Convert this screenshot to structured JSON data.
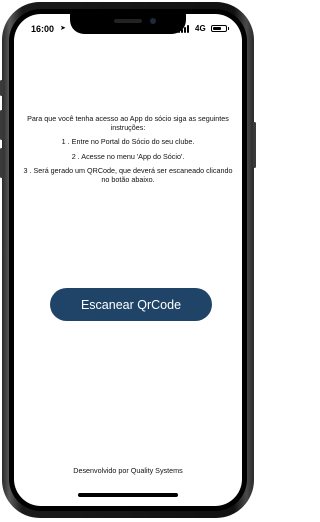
{
  "status_bar": {
    "time": "16:00",
    "network": "4G"
  },
  "instructions": {
    "intro": "Para que você tenha acesso ao App do sócio siga as seguintes instruções:",
    "step1": "1 . Entre no Portal do Sócio do seu clube.",
    "step2": "2 . Acesse no menu 'App do Sócio'.",
    "step3": "3 . Será gerado um QRCode, que deverá ser escaneado clicando no botão abaixo."
  },
  "actions": {
    "scan_label": "Escanear QrCode"
  },
  "footer": {
    "credit": "Desenvolvido por Quality Systems"
  },
  "colors": {
    "button_background": "#1f4468",
    "button_text": "#ffffff",
    "screen_background": "#ffffff"
  },
  "icons": {
    "location": "location-arrow-icon",
    "signal": "cellular-signal-icon",
    "battery": "battery-icon"
  }
}
